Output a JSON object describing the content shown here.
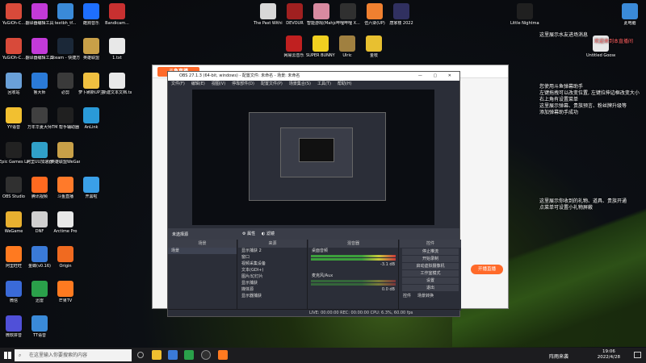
{
  "desktop": {
    "icons_left": [
      {
        "label": "YuGiOh-C...",
        "color": "#d84a3a"
      },
      {
        "label": "翻译器编辑工具",
        "color": "#c23ad8"
      },
      {
        "label": "textbh_tf...",
        "color": "#3a8ad8"
      },
      {
        "label": "酷狗音乐",
        "color": "#1e6fff"
      },
      {
        "label": "Bandicam...",
        "color": "#c83030"
      },
      {
        "label": "YuGiOh-C...",
        "color": "#d84a3a"
      },
      {
        "label": "翻译器编辑工具",
        "color": "#c23ad8"
      },
      {
        "label": "Steam - 快捷方式",
        "color": "#1b2838"
      },
      {
        "label": "英雄联盟",
        "color": "#c8a048"
      },
      {
        "label": "1.txt",
        "color": "#e8e8e8"
      },
      {
        "label": "回收站",
        "color": "#6aa0d8"
      },
      {
        "label": "鲁大师",
        "color": "#2a7ad8"
      },
      {
        "label": "必剪",
        "color": "#3a3a3a"
      },
      {
        "label": "萝卜刷新UP主",
        "color": "#f0c040"
      },
      {
        "label": "新建文本文档.txt",
        "color": "#e8e8e8"
      },
      {
        "label": "YY语音",
        "color": "#f2c030"
      },
      {
        "label": "万年华夏大师",
        "color": "#404040"
      },
      {
        "label": "TM 帮手辅助器",
        "color": "#202020"
      },
      {
        "label": "AnLink",
        "color": "#2a9ad8"
      },
      {
        "label": "Epic Games Launcher",
        "color": "#222222"
      },
      {
        "label": "阿里UU加速器",
        "color": "#30a0c8"
      },
      {
        "label": "英雄联盟WeGame版",
        "color": "#c8a048"
      },
      {
        "label": "OBS Studio",
        "color": "#303030"
      },
      {
        "label": "腾讯视频",
        "color": "#ff6a20"
      },
      {
        "label": "斗鱼直播",
        "color": "#ff7a2a"
      },
      {
        "label": "开黑啦",
        "color": "#3aa0e8"
      },
      {
        "label": "WeGame",
        "color": "#e8b030"
      },
      {
        "label": "DNF",
        "color": "#d0d0d0"
      },
      {
        "label": "Arctime Pro",
        "color": "#e8e8e8"
      },
      {
        "label": "阿里旺旺",
        "color": "#ff7a20"
      },
      {
        "label": "金蝶(v0.16)",
        "color": "#3a7ad8"
      },
      {
        "label": "Origin",
        "color": "#f06a20"
      },
      {
        "label": "微信",
        "color": "#3a6ad8"
      },
      {
        "label": "迅雷",
        "color": "#2aa04a"
      },
      {
        "label": "芒果TV",
        "color": "#ff7a20"
      },
      {
        "label": "微软拼音",
        "color": "#5050d8"
      },
      {
        "label": "TT语音",
        "color": "#3a8ad8"
      }
    ],
    "icons_top": [
      {
        "label": "The Past Within",
        "color": "#d8d8d8"
      },
      {
        "label": "DEVOUR",
        "color": "#a02020"
      },
      {
        "label": "智能游戏(Mahjong)",
        "color": "#d88aa0"
      },
      {
        "label": "哔哩哔哩 X...",
        "color": "#303030"
      },
      {
        "label": "伍六柒(UP)",
        "color": "#f08030"
      },
      {
        "label": "唐家楼 2022",
        "color": "#303060"
      },
      {
        "label": "网易云音乐",
        "color": "#c02020"
      },
      {
        "label": "SUPER BUNNY MAN",
        "color": "#f0d020"
      },
      {
        "label": "Ulric",
        "color": "#a08040"
      },
      {
        "label": "金枝",
        "color": "#e8c030"
      }
    ],
    "icons_right": [
      {
        "label": "Little Nightmares",
        "color": "#202020"
      },
      {
        "label": "此电脑",
        "color": "#3a8ad8"
      },
      {
        "label": "Untitled Goose...",
        "color": "#e8e8e8"
      }
    ]
  },
  "obs": {
    "title": "OBS 27.1.3 (64-bit, windows) - 配置文件: 未命名 - 场景: 未命名",
    "menu": [
      "文件(F)",
      "编辑(E)",
      "视图(V)",
      "停靠部件(D)",
      "配置文件(P)",
      "场景集合(S)",
      "工具(T)",
      "帮助(H)"
    ],
    "source_bar": {
      "title": "未选择源",
      "properties": "属性",
      "filters": "滤镜"
    },
    "scenes": {
      "header": "场景",
      "items": [
        "场景"
      ]
    },
    "sources": {
      "header": "来源",
      "items": [
        "显示捕获 2",
        "窗口",
        "视频采集设备",
        "文本(GDI+)",
        "图片/幻灯片",
        "显示捕获",
        "媒体源",
        "显示器捕获"
      ]
    },
    "mixer": {
      "header": "混音器",
      "channels": [
        {
          "name": "桌面音频",
          "level": "-3.1 dB"
        },
        {
          "name": "麦克风/Aux",
          "level": "0.0 dB"
        }
      ]
    },
    "controls": {
      "header": "控件",
      "buttons": [
        "停止推流",
        "开始录制",
        "启动虚拟摄像机",
        "工作室模式",
        "设置",
        "退出"
      ],
      "extra": [
        "控件",
        "场景转换"
      ]
    },
    "status": "LIVE: 00:00:00    REC: 00:00:00    CPU: 6.3%, 60.00 fps"
  },
  "app_bg": {
    "logo": "斗鱼直播",
    "button": "开播直播"
  },
  "chat": {
    "top": [
      "这里展示水友进场消息",
      "欢迎来到本直播间"
    ],
    "mid": [
      "您使用斗鱼弹幕助手",
      "左键拖拽可以改变位置, 左键拉伸边框改变大小",
      "右上角有设置菜单",
      "这里展示弹幕、贵族预言、粉丝牌升级等",
      "添加弹幕助手成功"
    ],
    "low": [
      "这里展示你收到的礼物、道具、贵族开通",
      "点菜单可设置小礼物屏蔽"
    ]
  },
  "taskbar": {
    "search_placeholder": "在这里输入你要搜索的内容",
    "weather": "阵雨来袭",
    "time": "19:06",
    "date": "2022/4/28"
  }
}
